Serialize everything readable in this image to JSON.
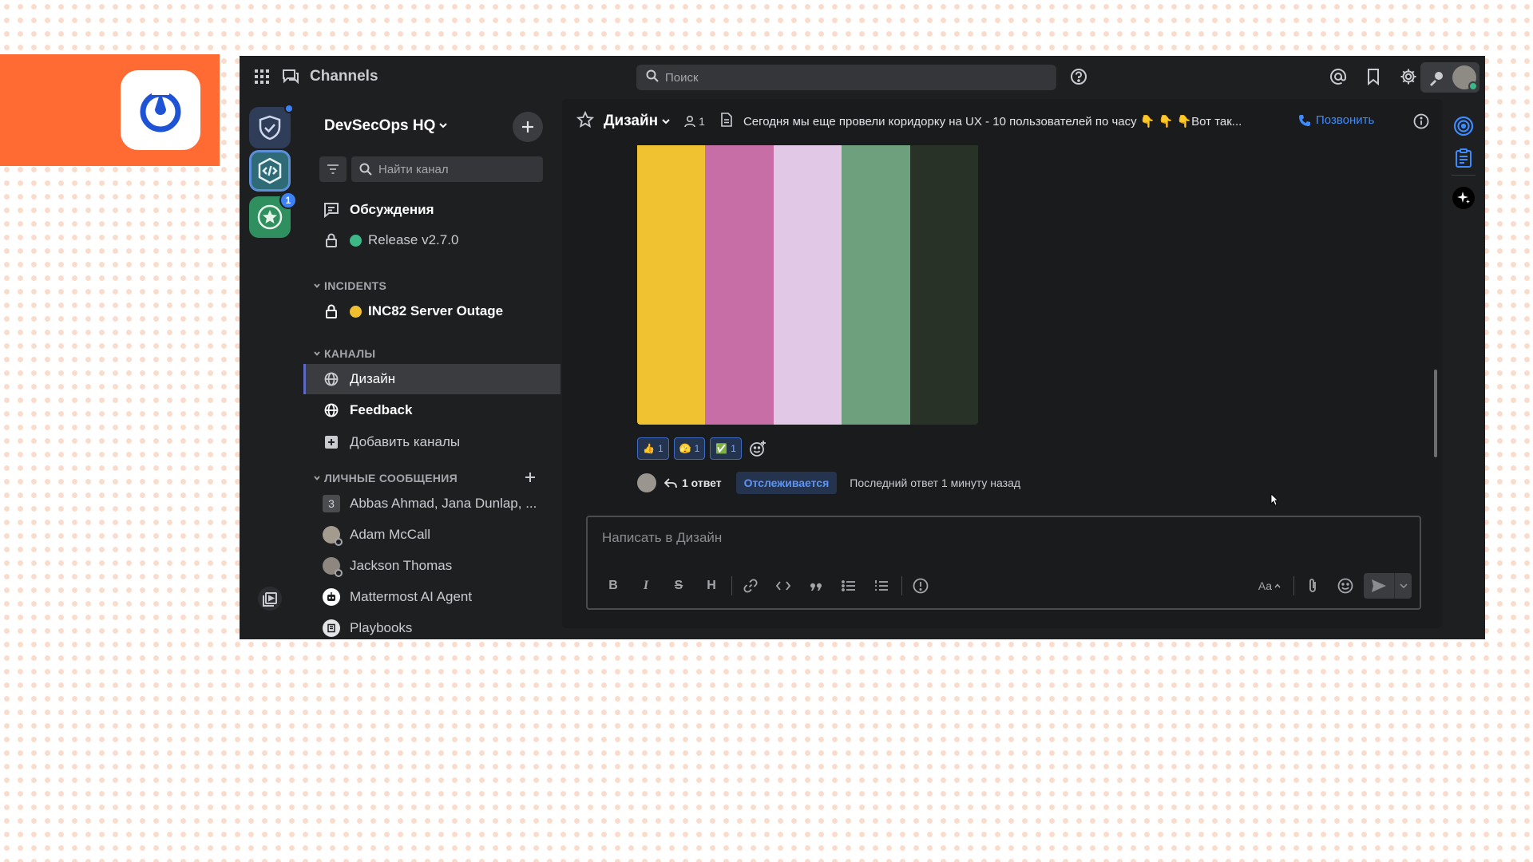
{
  "header": {
    "product_name": "Channels",
    "search_placeholder": "Поиск"
  },
  "team": {
    "name": "DevSecOps HQ",
    "unread_badge": "1"
  },
  "sidebar": {
    "find_channel_placeholder": "Найти канал",
    "threads_label": "Обсуждения",
    "release_channel": "Release v2.7.0",
    "incidents_section": "INCIDENTS",
    "incident_channel": "INC82 Server Outage",
    "channels_section": "КАНАЛЫ",
    "channels": [
      {
        "label": "Дизайн"
      },
      {
        "label": "Feedback"
      }
    ],
    "add_channels_label": "Добавить каналы",
    "dm_section": "ЛИЧНЫЕ СООБЩЕНИЯ",
    "dms": [
      {
        "count": "3",
        "label": "Abbas Ahmad, Jana Dunlap, ..."
      },
      {
        "label": "Adam McCall"
      },
      {
        "label": "Jackson Thomas"
      },
      {
        "label": "Mattermost AI Agent"
      },
      {
        "label": "Playbooks"
      }
    ]
  },
  "channel": {
    "name": "Дизайн",
    "member_count": "1",
    "purpose": "Сегодня мы еще провели коридорку на UX - 10 пользователей по часу 👇 👇 👇Вот так...",
    "call_label": "Позвонить"
  },
  "message": {
    "image_colors": [
      "#f0c232",
      "#c76ea6",
      "#e1c8e6",
      "#6fa07e",
      "#283227"
    ],
    "reactions": [
      {
        "emoji": "👍",
        "count": "1"
      },
      {
        "emoji": "🫣",
        "count": "1"
      },
      {
        "emoji": "✅",
        "count": "1"
      }
    ],
    "reply_count_label": "1 ответ",
    "following_label": "Отслеживается",
    "last_reply_label": "Последний ответ 1 минуту назад"
  },
  "composer": {
    "placeholder": "Написать в Дизайн",
    "format_buttons": {
      "bold": "B",
      "italic": "I",
      "strike": "S",
      "heading": "H"
    },
    "text_style_label": "Aa"
  },
  "colors": {
    "brand_orange": "#ff6b33",
    "accent_blue": "#3d8bff",
    "app_bg": "#1e1f21"
  }
}
